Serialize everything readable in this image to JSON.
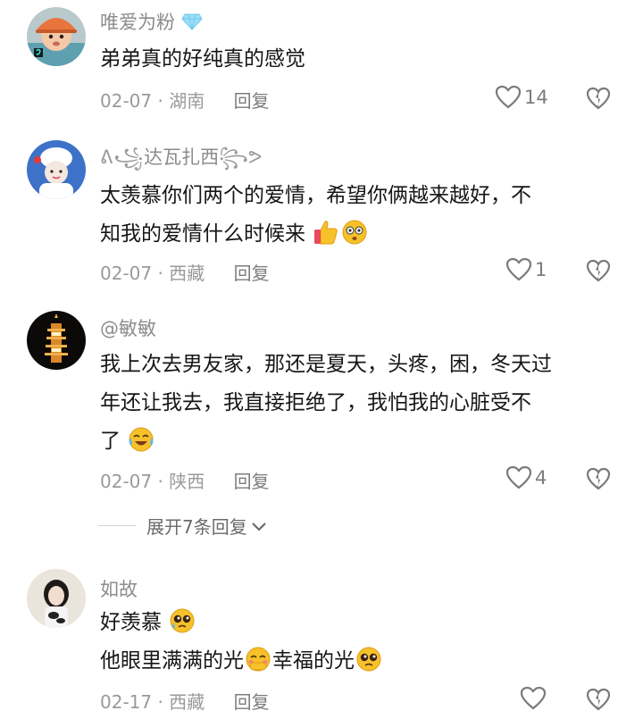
{
  "comments": [
    {
      "username": "唯爱为粉",
      "text_lines": [
        "弟弟真的好纯真的感觉"
      ],
      "date": "02-07",
      "location": "湖南",
      "reply_label": "回复",
      "likes": "14",
      "avatar_icon": "toddler-avatar"
    },
    {
      "username": "达瓦扎西",
      "text_lines": [
        "太羡慕你们两个的爱情，希望你俩越来越好，不",
        "知我的爱情什么时候来"
      ],
      "emojis": [
        "thumbs-up-emoji",
        "flushed-face-emoji"
      ],
      "date": "02-07",
      "location": "西藏",
      "reply_label": "回复",
      "likes": "1",
      "avatar_icon": "chef-doll-avatar"
    },
    {
      "username": "@敏敏",
      "text_lines": [
        "我上次去男友家，那还是夏天，头疼，困，冬天过",
        "年还让我去，我直接拒绝了，我怕我的心脏受不",
        "了"
      ],
      "emojis": [
        "crying-laughing-emoji"
      ],
      "date": "02-07",
      "location": "陕西",
      "reply_label": "回复",
      "likes": "4",
      "avatar_icon": "pagoda-night-avatar"
    },
    {
      "username": "如故",
      "text_lines": [
        "好羡慕",
        "他眼里满满的光",
        "幸福的光"
      ],
      "emojis": [
        "pleading-face-emoji",
        "blushing-face-emoji",
        "pleading-face-emoji"
      ],
      "date": "02-17",
      "location": "西藏",
      "reply_label": "回复",
      "likes": "",
      "avatar_icon": "girl-photo-avatar"
    }
  ],
  "expand_replies": "展开7条回复",
  "colors": {
    "text": "#161616",
    "meta": "#9a9a9a",
    "emoji_yellow": "#f7c12a",
    "diamond": "#7fd3f5"
  }
}
